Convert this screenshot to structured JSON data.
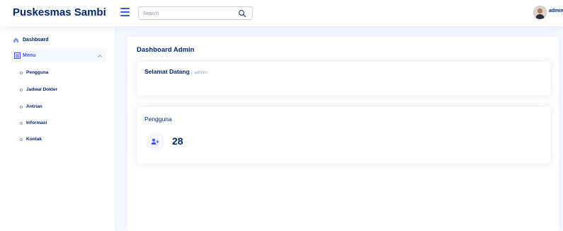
{
  "header": {
    "logo": "Puskesmas Sambi",
    "search_placeholder": "Search",
    "user_name": "admin"
  },
  "sidebar": {
    "dashboard_label": "Dashboard",
    "menu_label": "Menu",
    "submenu": [
      "Pengguna",
      "Jadwal Dokter",
      "Antrian",
      "Informasi",
      "Kontak"
    ]
  },
  "main": {
    "page_title": "Dashboard Admin",
    "welcome_title": "Selamat Datang",
    "welcome_separator": "|",
    "welcome_user": "admin",
    "stat_title": "Pengguna",
    "stat_value": "28"
  },
  "colors": {
    "primary": "#4154f1",
    "text": "#012970",
    "background": "#f6f9ff"
  },
  "icons": {
    "toggle": "hamburger-icon",
    "search": "search-icon",
    "dashboard": "grid-icon",
    "menu": "menu-icon",
    "chevron": "chevron-up-icon",
    "stat": "people-plus-icon"
  }
}
